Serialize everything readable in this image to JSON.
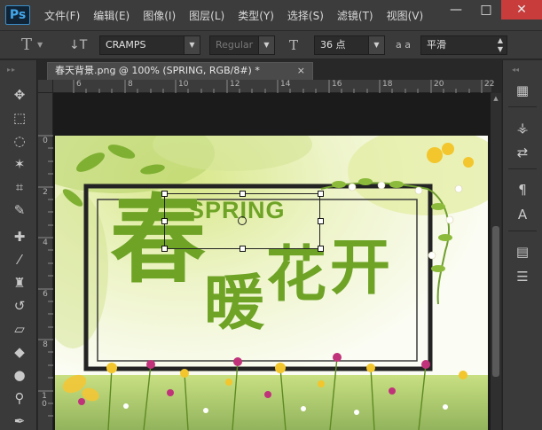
{
  "app": {
    "logo": "Ps",
    "menu": [
      "文件(F)",
      "编辑(E)",
      "图像(I)",
      "图层(L)",
      "类型(Y)",
      "选择(S)",
      "滤镜(T)",
      "视图(V)"
    ],
    "window_controls": {
      "minimize": "—",
      "maximize": "□",
      "close": "✕"
    }
  },
  "options_bar": {
    "tool_icon": "T",
    "orientation_icon": "↓T",
    "font_family": "CRAMPS",
    "font_style": "Regular",
    "size_icon": "T",
    "font_size": "36 点",
    "aa_icon": "a a",
    "anti_alias": "平滑"
  },
  "document": {
    "tab_title": "春天背景.png @ 100% (SPRING, RGB/8#) *",
    "tab_close": "×",
    "ruler_h": [
      "6",
      "8",
      "10",
      "12",
      "14",
      "16",
      "18",
      "20",
      "22"
    ],
    "ruler_v": [
      "0",
      "2",
      "4",
      "6",
      "8",
      "1 0"
    ]
  },
  "image": {
    "spring_text": "SPRING",
    "headline": [
      "春",
      "暖",
      "花",
      "开"
    ],
    "text_color": "#6ea326"
  },
  "colors": {
    "chrome": "#3a3a3a",
    "canvas": "#282828",
    "accent": "#43a7ea",
    "close": "#c83c3c"
  },
  "toolbox": [
    "move-tool-icon",
    "marquee-tool-icon",
    "lasso-tool-icon",
    "magic-wand-icon",
    "crop-tool-icon",
    "eyedropper-icon",
    "healing-brush-icon",
    "brush-tool-icon",
    "clone-stamp-icon",
    "history-brush-icon",
    "eraser-icon",
    "paint-bucket-icon",
    "blur-tool-icon",
    "dodge-tool-icon",
    "pen-tool-icon"
  ],
  "right_panel": [
    "brush-preset-icon",
    "brush-icon",
    "clone-source-icon",
    "paragraph-icon",
    "character-icon",
    "notes-icon",
    "properties-icon"
  ]
}
